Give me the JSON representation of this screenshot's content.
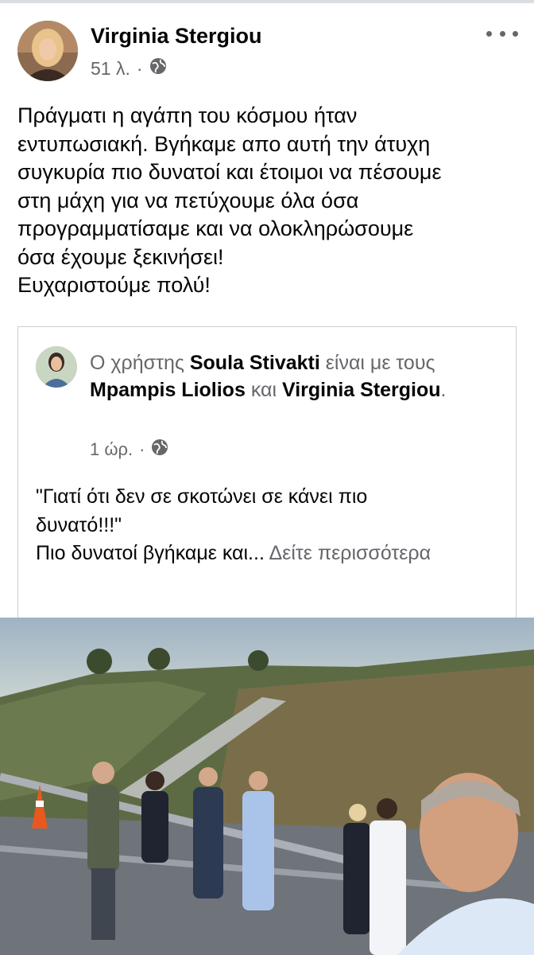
{
  "post": {
    "author": "Virginia Stergiou",
    "time": "51 λ.",
    "separator": "·",
    "audience_icon": "globe-icon",
    "more_icon": "more-options-icon",
    "text_lines": [
      "Πράγματι η αγάπη του κόσμου ήταν",
      "εντυπωσιακή. Βγήκαμε απο αυτή την άτυχη",
      "συγκυρία πιο δυνατοί και έτοιμοι να πέσουμε",
      "στη μάχη για να πετύχουμε όλα όσα",
      "προγραμματίσαμε και να ολοκληρώσουμε",
      "όσα έχουμε ξεκινήσει!",
      "Ευχαριστούμε πολύ!"
    ]
  },
  "shared": {
    "prefix": "Ο χρήστης",
    "author": "Soula Stivakti",
    "with_text": "είναι με τους",
    "tag1": "Mpampis Liolios",
    "and_text": "και",
    "tag2": "Virginia Stergiou",
    "period": ".",
    "time": "1 ώρ.",
    "separator": "·",
    "body_line1": "\"Γιατί ότι δεν σε σκοτώνει σε κάνει πιο",
    "body_line2": "δυνατό!!!\"",
    "body_line3": "Πιο δυνατοί βγήκαμε και...",
    "see_more": "Δείτε περισσότερα"
  },
  "colors": {
    "text": "#050505",
    "secondary": "#65676b",
    "border": "#ced0d4"
  }
}
